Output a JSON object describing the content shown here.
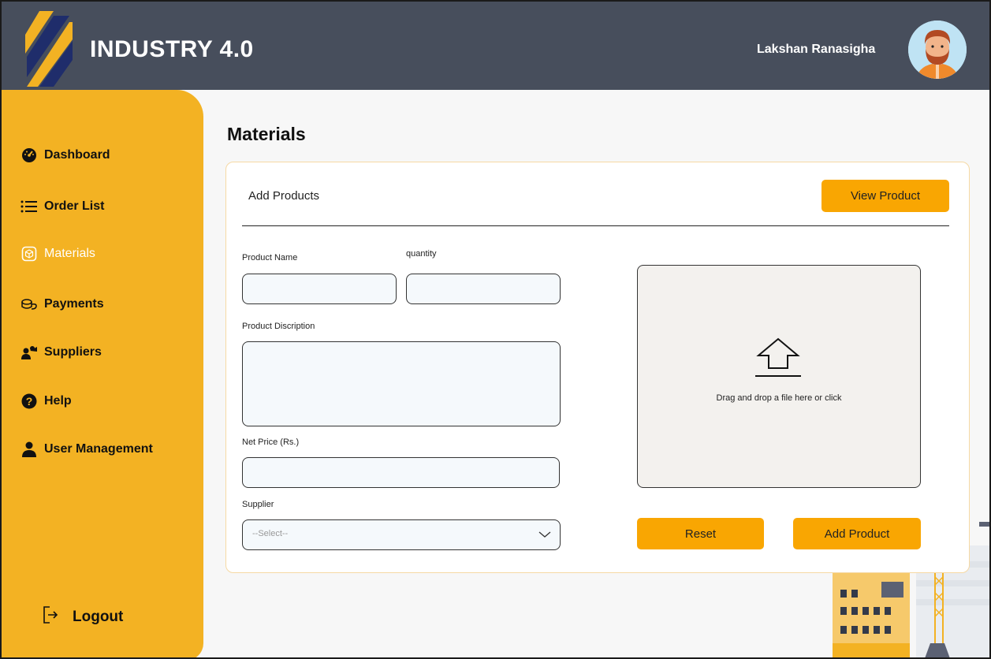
{
  "header": {
    "app_title": "INDUSTRY 4.0",
    "user_name": "Lakshan Ranasigha"
  },
  "sidebar": {
    "items": [
      {
        "label": "Dashboard",
        "icon": "speedometer-icon"
      },
      {
        "label": "Order List",
        "icon": "list-icon"
      },
      {
        "label": "Materials",
        "icon": "box-icon",
        "active": true
      },
      {
        "label": "Payments",
        "icon": "coins-icon"
      },
      {
        "label": "Suppliers",
        "icon": "users-icon"
      },
      {
        "label": "Help",
        "icon": "question-icon"
      },
      {
        "label": "User Management",
        "icon": "user-icon"
      }
    ],
    "logout_label": "Logout"
  },
  "main": {
    "page_title": "Materials",
    "card_title": "Add Products",
    "view_button": "View Product",
    "form": {
      "product_name_label": "Product Name",
      "quantity_label": "quantity",
      "description_label": "Product Discription",
      "net_price_label": "Net Price (Rs.)",
      "supplier_label": "Supplier",
      "supplier_placeholder": "--Select--"
    },
    "dropzone_text": "Drag and drop a file here or click",
    "reset_button": "Reset",
    "add_button": "Add Product"
  },
  "colors": {
    "header_bg": "#474e5c",
    "sidebar_bg": "#f3b223",
    "accent": "#f9a602"
  }
}
